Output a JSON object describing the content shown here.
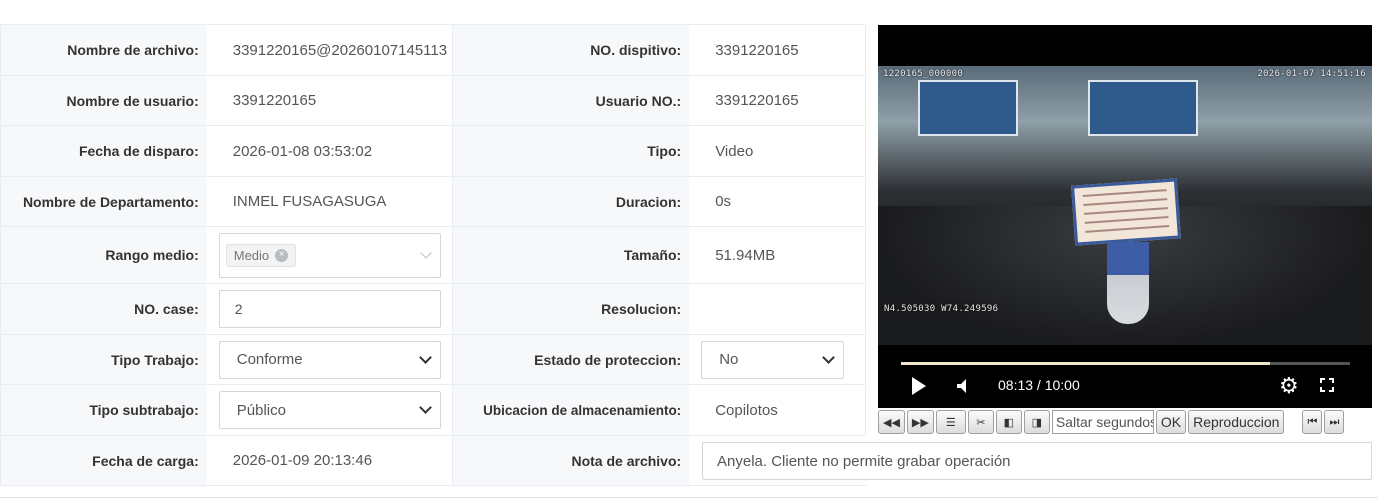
{
  "form": {
    "rows": [
      {
        "l1": "Nombre de archivo:",
        "v1": "3391220165@20260107145113",
        "l2": "NO. dispitivo:",
        "v2": "3391220165"
      },
      {
        "l1": "Nombre de usuario:",
        "v1": "3391220165",
        "l2": "Usuario NO.:",
        "v2": "3391220165"
      },
      {
        "l1": "Fecha de disparo:",
        "v1": "2026-01-08 03:53:02",
        "l2": "Tipo:",
        "v2": "Video"
      },
      {
        "l1": "Nombre de Departamento:",
        "v1": "INMEL FUSAGASUGA",
        "l2": "Duracion:",
        "v2": "0s"
      },
      {
        "l1": "Rango medio:",
        "v1": "Medio",
        "l2": "Tamaño:",
        "v2": "51.94MB"
      },
      {
        "l1": "NO. case:",
        "v1": "2",
        "l2": "Resolucion:",
        "v2": ""
      },
      {
        "l1": "Tipo Trabajo:",
        "v1": "Conforme",
        "l2": "Estado de proteccion:",
        "v2": "No"
      },
      {
        "l1": "Tipo subtrabajo:",
        "v1": "Público",
        "l2": "Ubicacion de almacenamiento:",
        "v2": "Copilotos"
      },
      {
        "l1": "Fecha de carga:",
        "v1": "2026-01-09 20:13:46",
        "l2": "Nota de archivo:",
        "v2": "Anyela. Cliente no permite grabar operación"
      }
    ]
  },
  "player": {
    "osd_id": "1220165_000000",
    "osd_datetime": "2026-01-07 14:51:16",
    "osd_gps": "N4.505030 W74.249596",
    "time": "08:13 / 10:00",
    "progress": 0.822
  },
  "toolbar": {
    "seek_placeholder": "Saltar segundos",
    "ok_label": "OK",
    "play_label": "Reproduccion"
  }
}
